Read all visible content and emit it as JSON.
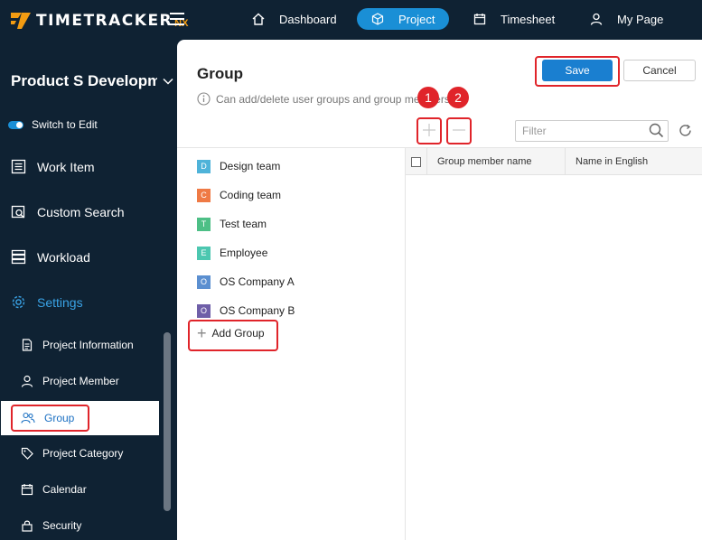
{
  "app": {
    "logo_text": "TIMETRACKER",
    "logo_suffix": "NX"
  },
  "topnav": [
    {
      "label": "Dashboard",
      "icon": "home-icon"
    },
    {
      "label": "Project",
      "icon": "cube-icon",
      "active": true
    },
    {
      "label": "Timesheet",
      "icon": "calendar-icon"
    },
    {
      "label": "My Page",
      "icon": "user-icon"
    }
  ],
  "sidebar": {
    "project_name": "Product S Developm",
    "switch_label": "Switch to Edit",
    "main_items": [
      {
        "label": "Work Item",
        "icon": "list-icon"
      },
      {
        "label": "Custom Search",
        "icon": "search-list-icon"
      },
      {
        "label": "Workload",
        "icon": "workload-icon"
      },
      {
        "label": "Settings",
        "icon": "gear-icon"
      }
    ],
    "sub_items": [
      {
        "label": "Project Information",
        "icon": "document-icon"
      },
      {
        "label": "Project Member",
        "icon": "user-icon"
      },
      {
        "label": "Group",
        "icon": "group-icon"
      },
      {
        "label": "Project Category",
        "icon": "tag-icon"
      },
      {
        "label": "Calendar",
        "icon": "calendar-icon"
      },
      {
        "label": "Security",
        "icon": "lock-icon"
      }
    ]
  },
  "main": {
    "title": "Group",
    "subtitle": "Can add/delete user groups and group members.",
    "save_label": "Save",
    "cancel_label": "Cancel",
    "filter_placeholder": "Filter",
    "add_group_label": "Add Group",
    "groups": [
      {
        "letter": "D",
        "name": "Design team",
        "color": "#4fb3d9"
      },
      {
        "letter": "C",
        "name": "Coding team",
        "color": "#ef7a45"
      },
      {
        "letter": "T",
        "name": "Test team",
        "color": "#4dbf86"
      },
      {
        "letter": "E",
        "name": "Employee",
        "color": "#4cc7b0"
      },
      {
        "letter": "O",
        "name": "OS Company A",
        "color": "#5b8fd0"
      },
      {
        "letter": "O",
        "name": "OS Company B",
        "color": "#6f5fa8"
      }
    ],
    "table_headers": [
      "Group member name",
      "Name in English"
    ]
  },
  "callouts": {
    "num1": "1",
    "num2": "2"
  },
  "colors": {
    "accent": "#1a8fd6",
    "highlight": "#e0242a",
    "sidebar_bg": "#0f2233"
  }
}
